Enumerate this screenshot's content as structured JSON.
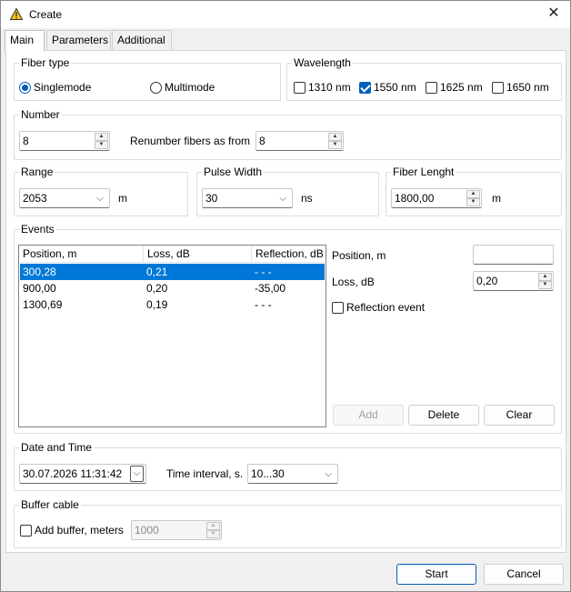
{
  "window": {
    "title": "Create",
    "close_glyph": "✕",
    "title_icon": "warning-triangle-icon"
  },
  "tabs": [
    {
      "label": "Main",
      "active": true
    },
    {
      "label": "Parameters",
      "active": false
    },
    {
      "label": "Additional",
      "active": false
    }
  ],
  "fiber_type": {
    "label": "Fiber type",
    "options": [
      "Singlemode",
      "Multimode"
    ],
    "selected": "Singlemode"
  },
  "wavelength": {
    "label": "Wavelength",
    "options": [
      {
        "label": "1310 nm",
        "checked": false
      },
      {
        "label": "1550 nm",
        "checked": true
      },
      {
        "label": "1625 nm",
        "checked": false
      },
      {
        "label": "1650 nm",
        "checked": false
      }
    ]
  },
  "number": {
    "label": "Number",
    "value": "8",
    "renumber_label": "Renumber fibers as from",
    "renumber_value": "8"
  },
  "range": {
    "label": "Range",
    "value": "2053",
    "unit": "m"
  },
  "pulse_width": {
    "label": "Pulse Width",
    "value": "30",
    "unit": "ns"
  },
  "fiber_length": {
    "label": "Fiber Lenght",
    "value": "1800,00",
    "unit": "m"
  },
  "events": {
    "label": "Events",
    "columns": [
      "Position,  m",
      "Loss,  dB",
      "Reflection,  dB"
    ],
    "rows": [
      [
        "300,28",
        "0,21",
        "- - -"
      ],
      [
        "900,00",
        "0,20",
        "-35,00"
      ],
      [
        "1300,69",
        "0,19",
        "- - -"
      ]
    ],
    "selected_row": 0,
    "position_label": "Position,  m",
    "position_value": "",
    "loss_label": "Loss,  dB",
    "loss_value": "0,20",
    "reflection_label": "Reflection event",
    "reflection_checked": false,
    "add_label": "Add",
    "delete_label": "Delete",
    "clear_label": "Clear"
  },
  "date_time": {
    "label": "Date and Time",
    "value": "30.07.2026    11:31:42",
    "interval_label": "Time interval, s.",
    "interval_value": "10...30"
  },
  "buffer": {
    "label": "Buffer cable",
    "checkbox_label": "Add buffer, meters",
    "checked": false,
    "value": "1000"
  },
  "footer": {
    "start_label": "Start",
    "cancel_label": "Cancel"
  },
  "colors": {
    "accent": "#005fb8",
    "selection": "#0078d7",
    "warning_icon": "#f2c811"
  }
}
